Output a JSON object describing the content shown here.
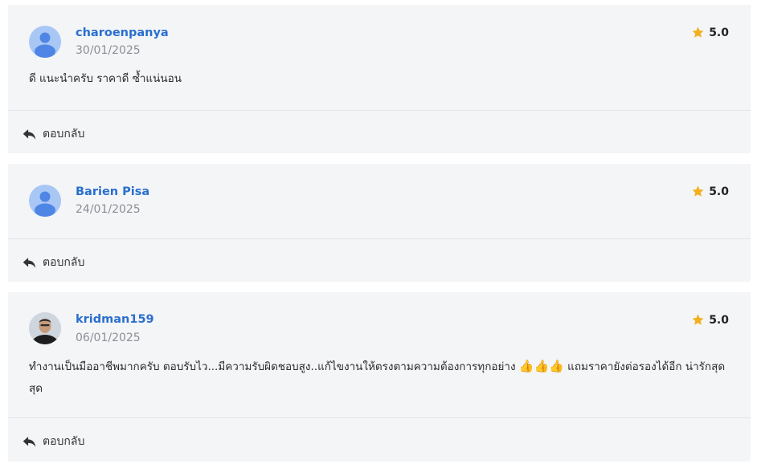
{
  "reviews": [
    {
      "username": "charoenpanya",
      "date": "30/01/2025",
      "rating": "5.0",
      "comment": "ดี แนะนำครับ ราคาดี ซ้ำแน่นอน",
      "reply_label": "ตอบกลับ",
      "avatar": "default-avatar"
    },
    {
      "username": "Barien Pisa",
      "date": "24/01/2025",
      "rating": "5.0",
      "comment": "",
      "reply_label": "ตอบกลับ",
      "avatar": "default-avatar"
    },
    {
      "username": "kridman159",
      "date": "06/01/2025",
      "rating": "5.0",
      "comment_part1": " ทำงานเป็นมืออาชีพมากครับ ตอบรับไว...มีความรับผิดชอบสูง..แก้ไขงานให้ตรงตามความต้องการทุกอย่าง ",
      "comment_emoji": "👍👍👍",
      "comment_part2": " แถมราคายังต่อรองได้อีก น่ารักสุดสุด",
      "reply_label": "ตอบกลับ",
      "avatar": "user-photo"
    }
  ],
  "colors": {
    "card_bg": "#f4f5f7",
    "username": "#2a6fcf",
    "star": "#f2b01e",
    "avatar_placeholder": "#a9c7f5",
    "avatar_figure": "#4f86e6"
  },
  "icons": {
    "star": "star-icon",
    "reply": "reply-arrow-icon",
    "avatar": "user-avatar-icon"
  }
}
